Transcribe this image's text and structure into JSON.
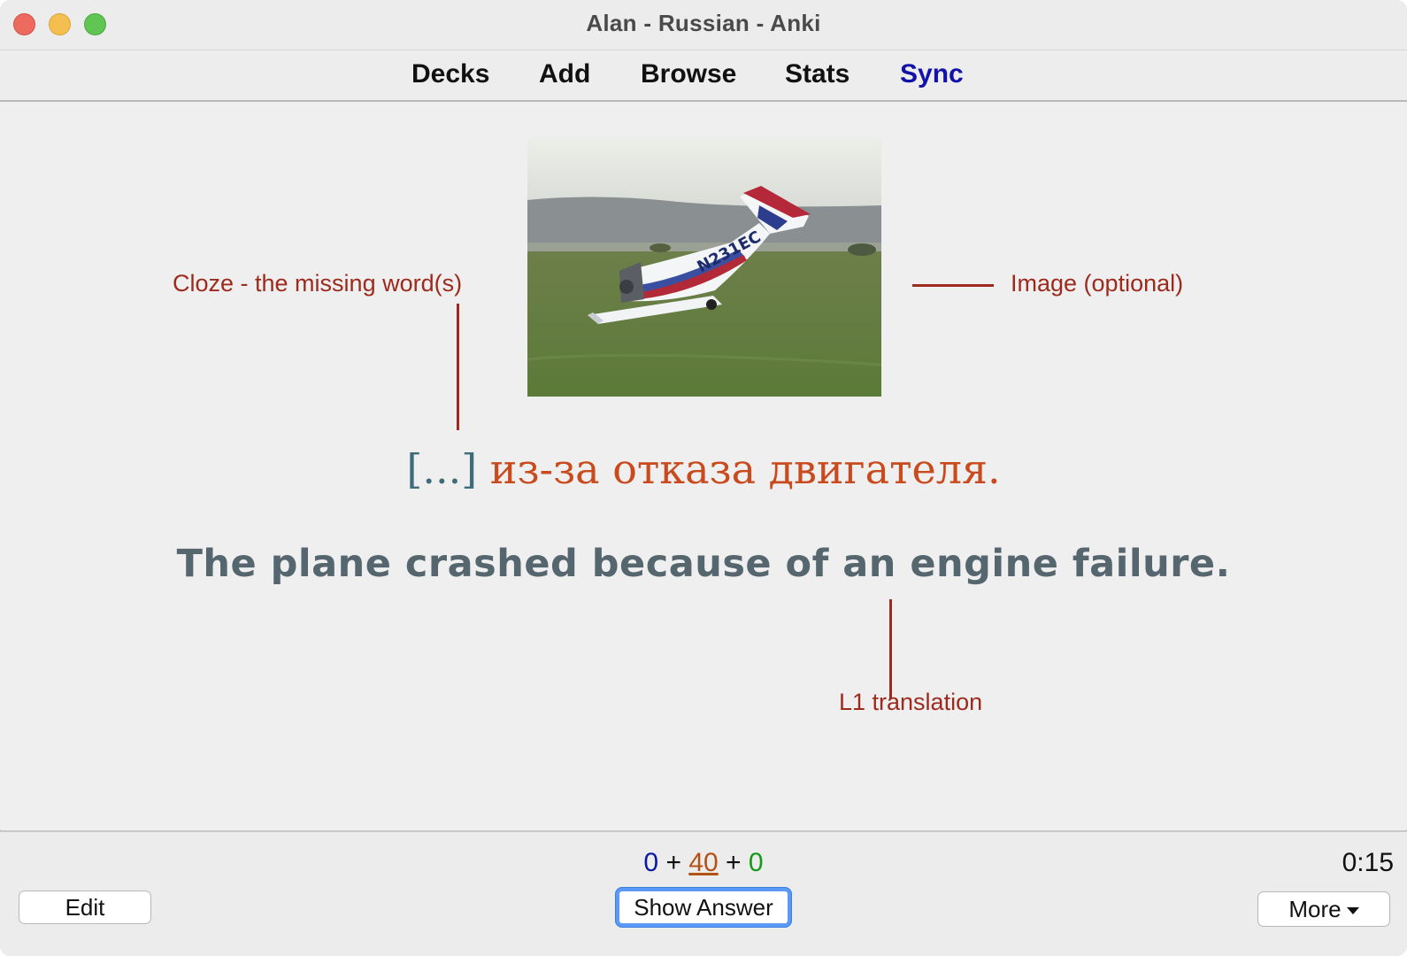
{
  "window": {
    "title": "Alan - Russian - Anki"
  },
  "toolbar": {
    "items": [
      {
        "label": "Decks"
      },
      {
        "label": "Add"
      },
      {
        "label": "Browse"
      },
      {
        "label": "Stats"
      },
      {
        "label": "Sync"
      }
    ]
  },
  "card": {
    "cloze_marker": "[...]",
    "sentence_rest": " из-за отказа двигателя.",
    "translation": "The plane crashed because of an engine failure.",
    "image_label": "N231EC"
  },
  "annotations": {
    "cloze": "Cloze - the missing word(s)",
    "image": "Image (optional)",
    "translation": "L1 translation",
    "color": "#9d2a1d"
  },
  "bottom": {
    "counts": {
      "new": "0",
      "sep1": " + ",
      "learning": "40",
      "sep2": " + ",
      "review": "0"
    },
    "timer": "0:15",
    "edit_label": "Edit",
    "show_answer_label": "Show Answer",
    "more_label": "More"
  }
}
